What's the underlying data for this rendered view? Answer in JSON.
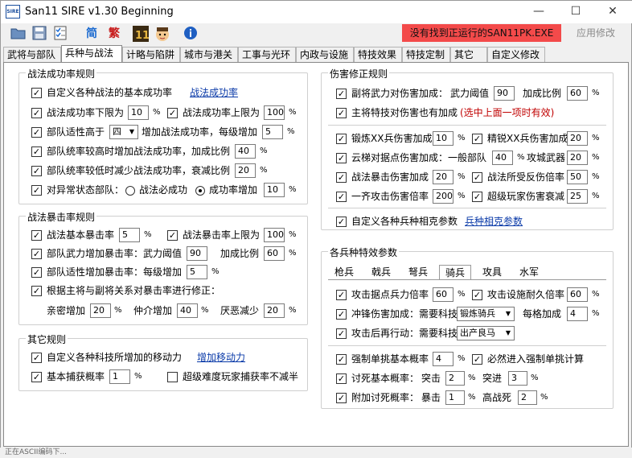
{
  "window": {
    "title": "San11 SIRE v1.30 Beginning",
    "logo": "SIRE",
    "minimize": "—",
    "maximize": "☐",
    "close": "✕"
  },
  "toolbar": {
    "status": "没有找到正运行的SAN11PK.EXE",
    "apply": "应用修改",
    "simplified": "简",
    "traditional": "繁",
    "icons": [
      "open-folder-icon",
      "save-disk-icon",
      "checklist-icon",
      "simplified-chinese-icon",
      "traditional-chinese-icon",
      "san11-game-icon",
      "avatar-icon",
      "info-icon"
    ]
  },
  "tabs": [
    "武将与部队",
    "兵种与战法",
    "计略与陷阱",
    "城市与港关",
    "工事与光环",
    "内政与设施",
    "特技效果",
    "特技定制",
    "其它",
    "自定义修改"
  ],
  "tactic_rate": {
    "title": "战法成功率规则",
    "custom": {
      "label": "自定义各种战法的基本成功率",
      "link": "战法成功率"
    },
    "min": {
      "label": "战法成功率下限为",
      "value": "10",
      "unit": "%"
    },
    "max": {
      "label": "战法成功率上限为",
      "value": "100",
      "unit": "%"
    },
    "aptitude": {
      "label": "部队适性高于",
      "select": "四",
      "label2": "增加战法成功率，每级增加",
      "value": "5",
      "unit": "%"
    },
    "lead_high": {
      "label": "部队统率较高时增加战法成功率，加成比例",
      "value": "40",
      "unit": "%"
    },
    "lead_low": {
      "label": "部队统率较低时减少战法成功率，衰减比例",
      "value": "20",
      "unit": "%"
    },
    "abnormal": {
      "label": "对异常状态部队：",
      "opt1": "战法必成功",
      "opt2": "成功率增加",
      "value": "10",
      "unit": "%"
    }
  },
  "crit_rate": {
    "title": "战法暴击率规则",
    "base": {
      "label": "战法基本暴击率",
      "value": "5",
      "unit": "%"
    },
    "cap": {
      "label": "战法暴击率上限为",
      "value": "100",
      "unit": "%"
    },
    "force": {
      "label": "部队武力增加暴击率：武力阈值",
      "value": "90",
      "label2": "加成比例",
      "value2": "60",
      "unit": "%"
    },
    "aptitude": {
      "label": "部队适性增加暴击率：每级增加",
      "value": "5",
      "unit": "%"
    },
    "relation": {
      "label": "根据主将与副将关系对暴击率进行修正："
    },
    "intimate": {
      "label": "亲密增加",
      "value": "20",
      "unit": "%"
    },
    "mediator": {
      "label": "仲介增加",
      "value": "40",
      "unit": "%"
    },
    "dislike": {
      "label": "厌恶减少",
      "value": "20",
      "unit": "%"
    }
  },
  "other": {
    "title": "其它规则",
    "tech_move": {
      "label": "自定义各种科技所增加的移动力",
      "link": "增加移动力"
    },
    "capture": {
      "label": "基本捕获概率",
      "value": "1",
      "unit": "%"
    },
    "hard": {
      "label": "超级难度玩家捕获率不减半"
    }
  },
  "damage": {
    "title": "伤害修正规则",
    "vice_force": {
      "label": "副将武力对伤害加成：",
      "label2": "武力阈值",
      "value": "90",
      "label3": "加成比例",
      "value2": "60",
      "unit": "%"
    },
    "main_skill": {
      "label": "主将特技对伤害也有加成",
      "note": "(选中上面一项时有效)"
    },
    "forge": {
      "label": "锻炼XX兵伤害加成",
      "value": "10",
      "unit": "%"
    },
    "elite": {
      "label": "精锐XX兵伤害加成",
      "value": "20",
      "unit": "%"
    },
    "ladder": {
      "label": "云梯对据点伤害加成：一般部队",
      "value": "40",
      "unit": "%",
      "label2": "攻城武器",
      "value2": "20"
    },
    "tactic_crit": {
      "label": "战法暴击伤害加成",
      "value": "20",
      "unit": "%"
    },
    "tactic_counter": {
      "label": "战法所受反伤倍率",
      "value": "50",
      "unit": "%"
    },
    "volley": {
      "label": "一齐攻击伤害倍率",
      "value": "200",
      "unit": "%"
    },
    "super_player": {
      "label": "超级玩家伤害衰减",
      "value": "25",
      "unit": "%"
    },
    "counter": {
      "label": "自定义各种兵种相克参数",
      "link": "兵种相克参数"
    }
  },
  "unit_params": {
    "title": "各兵种特效参数",
    "subtabs": [
      "枪兵",
      "戟兵",
      "弩兵",
      "骑兵",
      "攻具",
      "水军"
    ],
    "atk_base": {
      "label": "攻击据点兵力倍率",
      "value": "60",
      "unit": "%"
    },
    "atk_durable": {
      "label": "攻击设施耐久倍率",
      "value": "60",
      "unit": "%"
    },
    "charge": {
      "label": "冲锋伤害加成：需要科技",
      "select": "锻炼骑兵",
      "label2": "每格加成",
      "value": "4",
      "unit": "%"
    },
    "reaction": {
      "label": "攻击后再行动：需要科技",
      "select": "出产良马"
    },
    "duel_base": {
      "label": "强制单挑基本概率",
      "value": "4",
      "unit": "%"
    },
    "duel_must": {
      "label": "必然进入强制单挑计算"
    },
    "kill": {
      "label": "讨死基本概率：",
      "l1": "突击",
      "v1": "2",
      "l2": "突进",
      "v2": "3",
      "unit": "%"
    },
    "extra_kill": {
      "label": "附加讨死概率：",
      "l1": "暴击",
      "v1": "1",
      "l2": "高战死",
      "v2": "2",
      "unit": "%"
    }
  },
  "statusbar": "正在ASCII编码下..."
}
